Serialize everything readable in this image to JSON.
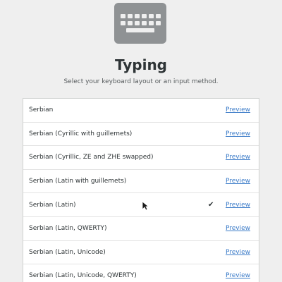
{
  "header": {
    "icon": "keyboard-icon",
    "title": "Typing",
    "subtitle": "Select your keyboard layout or an input method."
  },
  "layouts": [
    {
      "label": "Serbian",
      "preview": "Preview",
      "check": ""
    },
    {
      "label": "Serbian (Cyrillic with guillemets)",
      "preview": "Preview",
      "check": ""
    },
    {
      "label": "Serbian (Cyrillic, ZE and ZHE swapped)",
      "preview": "Preview",
      "check": ""
    },
    {
      "label": "Serbian (Latin with guillemets)",
      "preview": "Preview",
      "check": ""
    },
    {
      "label": "Serbian (Latin)",
      "preview": "Preview",
      "check": "✔"
    },
    {
      "label": "Serbian (Latin, QWERTY)",
      "preview": "Preview",
      "check": ""
    },
    {
      "label": "Serbian (Latin, Unicode)",
      "preview": "Preview",
      "check": ""
    },
    {
      "label": "Serbian (Latin, Unicode, QWERTY)",
      "preview": "Preview",
      "check": ""
    }
  ],
  "colors": {
    "background": "#efefef",
    "list_background": "#ffffff",
    "link": "#3b7bc8",
    "icon": "#8f9294"
  }
}
